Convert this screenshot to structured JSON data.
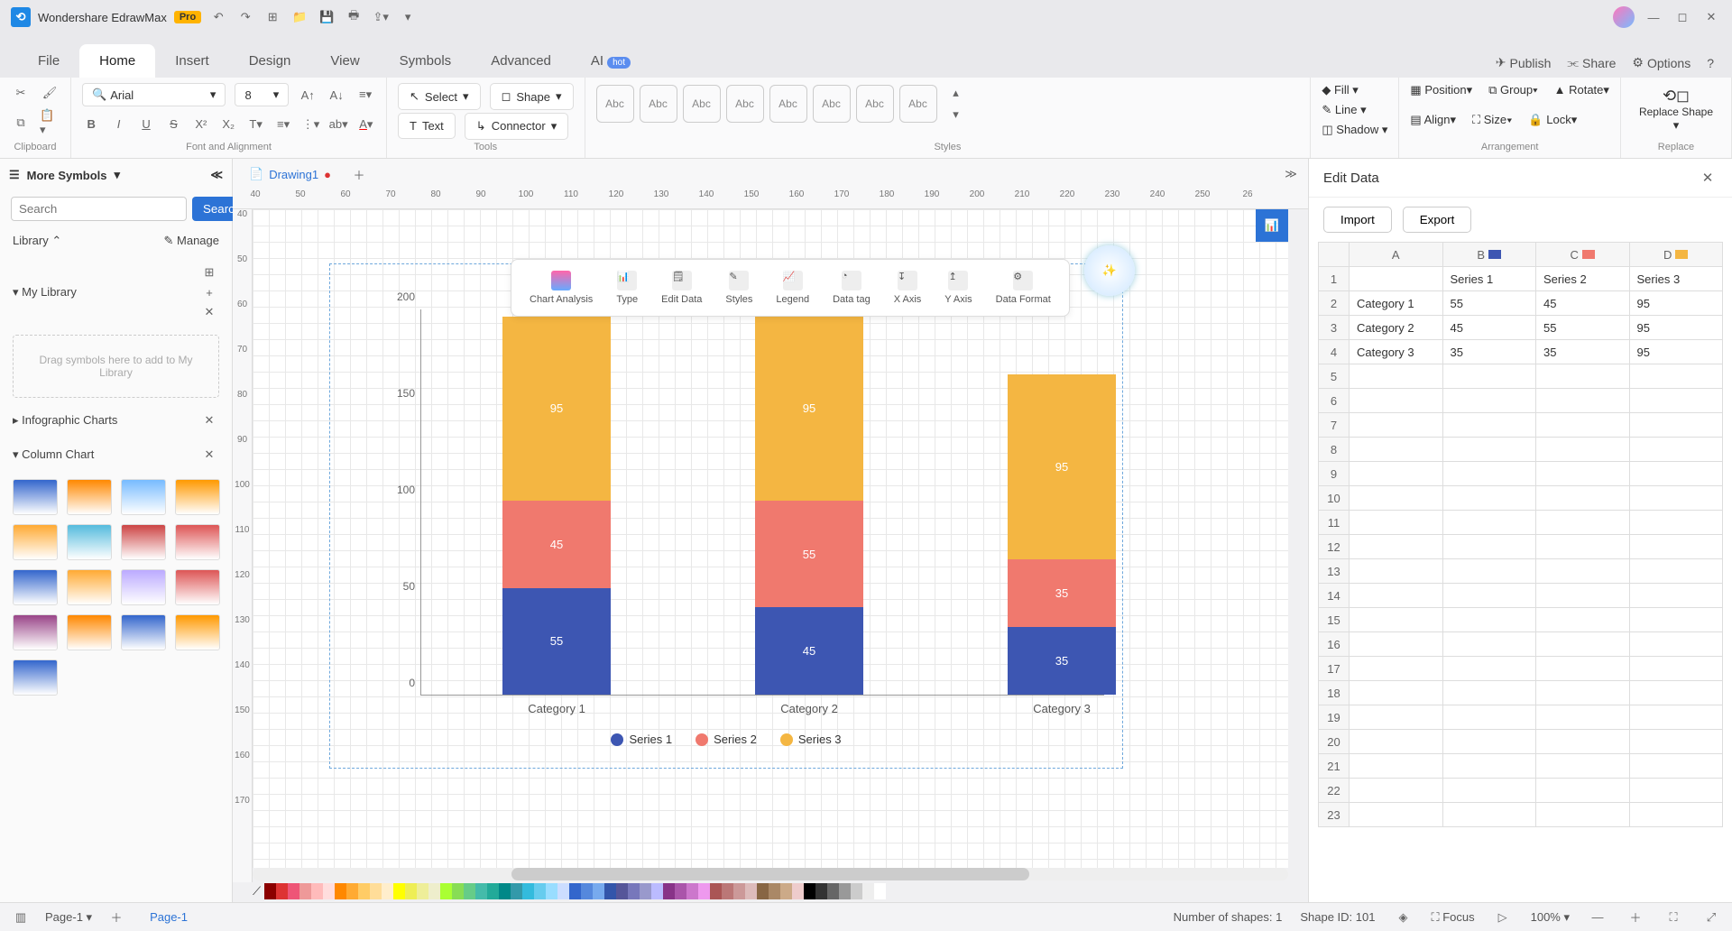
{
  "app": {
    "title": "Wondershare EdrawMax",
    "badge": "Pro"
  },
  "menu": {
    "items": [
      "File",
      "Home",
      "Insert",
      "Design",
      "View",
      "Symbols",
      "Advanced",
      "AI"
    ],
    "active": "Home",
    "right": {
      "publish": "Publish",
      "share": "Share",
      "options": "Options"
    }
  },
  "ribbon": {
    "clipboard": "Clipboard",
    "font_align": "Font and Alignment",
    "font": "Arial",
    "size": "8",
    "tools": "Tools",
    "select": "Select",
    "shape": "Shape",
    "text": "Text",
    "connector": "Connector",
    "styles_label": "Styles",
    "abc": "Abc",
    "fill": "Fill",
    "line": "Line",
    "shadow": "Shadow",
    "arrangement": "Arrangement",
    "position": "Position",
    "group": "Group",
    "rotate": "Rotate",
    "align": "Align",
    "size_lbl": "Size",
    "lock": "Lock",
    "replace": "Replace",
    "replace_shape": "Replace Shape"
  },
  "left": {
    "more": "More Symbols",
    "search_ph": "Search",
    "search_btn": "Search",
    "library": "Library",
    "manage": "Manage",
    "mylib": "My Library",
    "drop": "Drag symbols here to add to My Library",
    "infographic": "Infographic Charts",
    "column": "Column Chart"
  },
  "tabs": {
    "drawing": "Drawing1"
  },
  "chart_toolbar": [
    "Chart Analysis",
    "Type",
    "Edit Data",
    "Styles",
    "Legend",
    "Data tag",
    "X Axis",
    "Y Axis",
    "Data Format"
  ],
  "edit_data": {
    "title": "Edit Data",
    "import": "Import",
    "export": "Export"
  },
  "status": {
    "page": "Page-1",
    "page_tab": "Page-1",
    "shapes": "Number of shapes: 1",
    "shape_id": "Shape ID: 101",
    "focus": "Focus",
    "zoom": "100%"
  },
  "chart_data": {
    "type": "bar",
    "stacked": true,
    "categories": [
      "Category 1",
      "Category 2",
      "Category 3"
    ],
    "series": [
      {
        "name": "Series 1",
        "color": "#3d56b2",
        "values": [
          55,
          45,
          35
        ]
      },
      {
        "name": "Series 2",
        "color": "#f0796e",
        "values": [
          45,
          55,
          35
        ]
      },
      {
        "name": "Series 3",
        "color": "#f4b642",
        "values": [
          95,
          95,
          95
        ]
      }
    ],
    "ylim": [
      0,
      200
    ],
    "yticks": [
      0,
      50,
      100,
      150,
      200
    ]
  },
  "grid_cols": [
    "A",
    "B",
    "C",
    "D"
  ],
  "grid_rows": [
    "1",
    "2",
    "3",
    "4",
    "5",
    "6",
    "7",
    "8",
    "9",
    "10",
    "11",
    "12",
    "13",
    "14",
    "15",
    "16",
    "17",
    "18",
    "19",
    "20",
    "21",
    "22",
    "23"
  ],
  "grid_data": {
    "r1": [
      "",
      "Series 1",
      "Series 2",
      "Series 3"
    ],
    "r2": [
      "Category 1",
      "55",
      "45",
      "95"
    ],
    "r3": [
      "Category 2",
      "45",
      "55",
      "95"
    ],
    "r4": [
      "Category 3",
      "35",
      "35",
      "95"
    ]
  },
  "colors_strip": [
    "#8b0000",
    "#d33",
    "#e57",
    "#e99",
    "#fbb",
    "#fdd",
    "#f80",
    "#fa3",
    "#fc6",
    "#fd9",
    "#fec",
    "#ff0",
    "#ee5",
    "#ee9",
    "#eec",
    "#af3",
    "#8d5",
    "#6c8",
    "#4ba",
    "#2a9",
    "#088",
    "#39a",
    "#3bd",
    "#6ce",
    "#9df",
    "#cdf",
    "#36c",
    "#58d",
    "#7ae",
    "#35a",
    "#559",
    "#77b",
    "#99c",
    "#bbf",
    "#838",
    "#a5a",
    "#c7c",
    "#e9e",
    "#a55",
    "#b77",
    "#c99",
    "#dbb",
    "#864",
    "#a86",
    "#ca8",
    "#ecc",
    "#000",
    "#333",
    "#666",
    "#999",
    "#ccc",
    "#eee",
    "#fff"
  ]
}
